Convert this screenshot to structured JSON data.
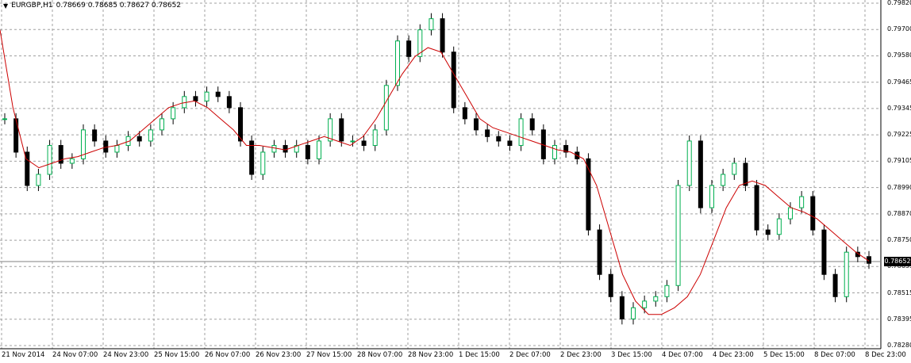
{
  "header": {
    "symbol": "EURGBP,H1",
    "ohlc": "0.78669 0.78685 0.78627 0.78652"
  },
  "current_price": "0.78652",
  "colors": {
    "background": "#ffffff",
    "grid": "#a0a0a0",
    "bull": "#00b050",
    "bear": "#000000",
    "candle_fill_bear": "#000000",
    "ma": "#cc0000",
    "axis_text": "#000000"
  },
  "chart_data": {
    "type": "line",
    "title": "EURGBP,H1",
    "y_axis_ticks": [
      "0.79820",
      "0.79700",
      "0.79580",
      "0.79465",
      "0.79345",
      "0.79225",
      "0.79105",
      "0.78990",
      "0.78870",
      "0.78750",
      "0.78635",
      "0.78515",
      "0.78395",
      "0.78280"
    ],
    "x_axis_ticks": [
      "21 Nov 2014",
      "24 Nov 07:00",
      "24 Nov 23:00",
      "25 Nov 15:00",
      "26 Nov 07:00",
      "26 Nov 23:00",
      "27 Nov 15:00",
      "28 Nov 07:00",
      "28 Nov 23:00",
      "1 Dec 15:00",
      "2 Dec 07:00",
      "2 Dec 23:00",
      "3 Dec 15:00",
      "4 Dec 07:00",
      "4 Dec 23:00",
      "5 Dec 15:00",
      "8 Dec 07:00",
      "8 Dec 23:00"
    ],
    "ylim": [
      0.7828,
      0.7982
    ],
    "grid": true,
    "series": [
      {
        "name": "",
        "values": [
          0.793,
          0.7915,
          0.79,
          0.7905,
          0.7918,
          0.791,
          0.7912,
          0.7925,
          0.792,
          0.7915,
          0.7918,
          0.7922,
          0.792,
          0.7925,
          0.793,
          0.7935,
          0.794,
          0.7938,
          0.7942,
          0.794,
          0.7935,
          0.792,
          0.7905,
          0.7915,
          0.7918,
          0.7915,
          0.7918,
          0.7912,
          0.792,
          0.793,
          0.792,
          0.792,
          0.7918,
          0.7925,
          0.7945,
          0.7965,
          0.7958,
          0.797,
          0.7975,
          0.796,
          0.7935,
          0.793,
          0.7925,
          0.7922,
          0.792,
          0.7918,
          0.793,
          0.7925,
          0.7912,
          0.7918,
          0.7915,
          0.7912,
          0.788,
          0.786,
          0.785,
          0.784,
          0.7845,
          0.7848,
          0.785,
          0.7855,
          0.79,
          0.792,
          0.789,
          0.79,
          0.7905,
          0.791,
          0.79,
          0.788,
          0.7878,
          0.7885,
          0.789,
          0.7895,
          0.788,
          0.786,
          0.785,
          0.787,
          0.7868,
          0.7865
        ]
      }
    ],
    "ma_series": {
      "name": "",
      "values": [
        0.797,
        0.7935,
        0.7912,
        0.7908,
        0.791,
        0.7912,
        0.7913,
        0.7915,
        0.7917,
        0.7918,
        0.792,
        0.7925,
        0.793,
        0.7935,
        0.7937,
        0.7938,
        0.7935,
        0.793,
        0.7925,
        0.7918,
        0.7918,
        0.7917,
        0.7916,
        0.7918,
        0.792,
        0.7922,
        0.792,
        0.7918,
        0.7922,
        0.793,
        0.794,
        0.795,
        0.7958,
        0.7962,
        0.796,
        0.795,
        0.794,
        0.793,
        0.7926,
        0.7924,
        0.7922,
        0.792,
        0.7918,
        0.7916,
        0.7915,
        0.7912,
        0.79,
        0.788,
        0.786,
        0.7848,
        0.7842,
        0.7842,
        0.7845,
        0.785,
        0.786,
        0.7875,
        0.789,
        0.79,
        0.7902,
        0.79,
        0.7895,
        0.789,
        0.7888,
        0.7885,
        0.788,
        0.7875,
        0.787,
        0.7866
      ]
    }
  }
}
